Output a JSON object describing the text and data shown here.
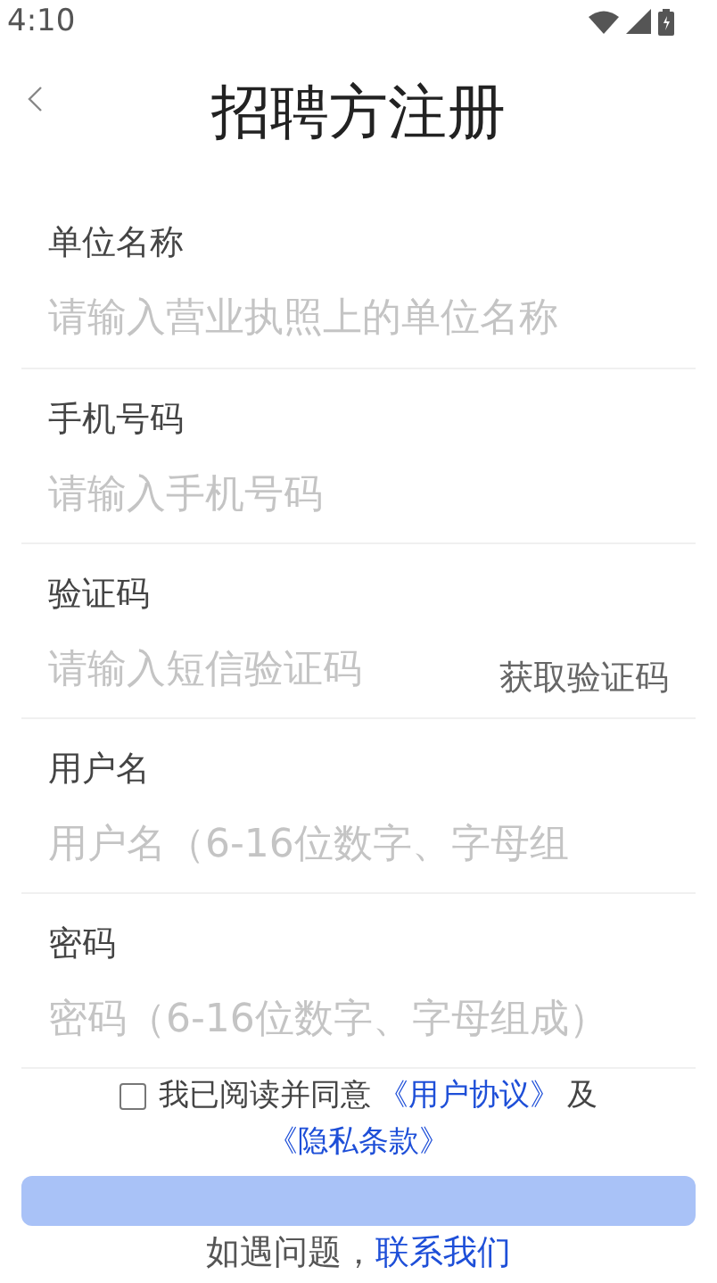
{
  "status_bar": {
    "time": "4:10"
  },
  "header": {
    "title": "招聘方注册"
  },
  "fields": [
    {
      "kind": "text",
      "label": "单位名称",
      "placeholder": "请输入营业执照上的单位名称"
    },
    {
      "kind": "text",
      "label": "手机号码",
      "placeholder": "请输入手机号码"
    },
    {
      "kind": "code",
      "label": "验证码",
      "placeholder": "请输入短信验证码",
      "action": "获取验证码"
    },
    {
      "kind": "text",
      "label": "用户名",
      "placeholder": "用户名（6-16位数字、字母组"
    },
    {
      "kind": "password",
      "label": "密码",
      "placeholder": "密码（6-16位数字、字母组成）"
    }
  ],
  "agreement": {
    "checked": false,
    "text": "我已阅读并同意",
    "link_1": "《用户协议》",
    "joiner": "及",
    "link_2": "《隐私条款》"
  },
  "footer": {
    "text": "如遇问题，",
    "link": "联系我们"
  }
}
